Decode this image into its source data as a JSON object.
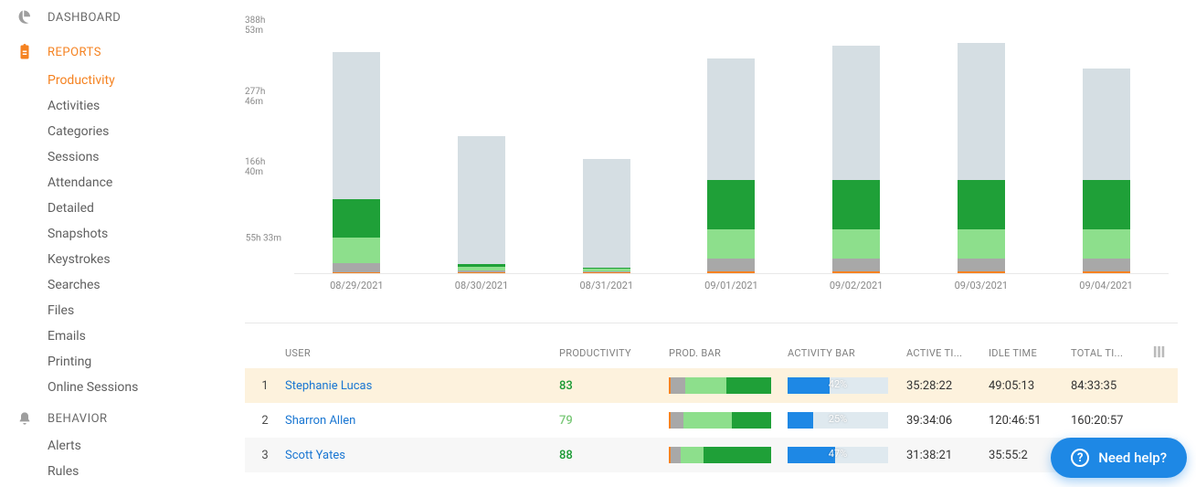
{
  "colors": {
    "idle": "#d5dee3",
    "green_dark": "#1fa038",
    "green_light": "#8ddf8c",
    "gray": "#a8a8a8",
    "orange": "#f58220",
    "blue": "#1e88e5",
    "barbg": "#dfe9ef"
  },
  "sidebar": {
    "dashboard": "DASHBOARD",
    "reports": "REPORTS",
    "behavior": "BEHAVIOR",
    "report_items": [
      "Productivity",
      "Activities",
      "Categories",
      "Sessions",
      "Attendance",
      "Detailed",
      "Snapshots",
      "Keystrokes",
      "Searches",
      "Files",
      "Emails",
      "Printing",
      "Online Sessions"
    ],
    "behavior_items": [
      "Alerts",
      "Rules"
    ]
  },
  "chart_data": {
    "type": "bar",
    "ylabel": "",
    "y_ticks": [
      "388h 53m",
      "277h 46m",
      "166h 40m",
      "55h 33m"
    ],
    "y_tick_values": [
      388.88,
      277.77,
      166.67,
      55.55
    ],
    "y_max": 388.88,
    "categories": [
      "08/29/2021",
      "08/30/2021",
      "08/31/2021",
      "09/01/2021",
      "09/02/2021",
      "09/03/2021",
      "09/04/2021"
    ],
    "stack_order": [
      "orange",
      "gray",
      "green_light",
      "green_dark",
      "idle"
    ],
    "series": [
      {
        "name": "orange",
        "color": "#f58220",
        "values": [
          2,
          1,
          1,
          3,
          3,
          3,
          3
        ]
      },
      {
        "name": "gray",
        "color": "#a8a8a8",
        "values": [
          14,
          3,
          2,
          20,
          20,
          20,
          20
        ]
      },
      {
        "name": "green_light",
        "color": "#8ddf8c",
        "values": [
          40,
          6,
          4,
          45,
          45,
          45,
          45
        ]
      },
      {
        "name": "green_dark",
        "color": "#1fa038",
        "values": [
          60,
          5,
          2,
          78,
          78,
          78,
          78
        ]
      },
      {
        "name": "idle",
        "color": "#d5dee3",
        "values": [
          230,
          200,
          170,
          190,
          210,
          215,
          175
        ]
      }
    ]
  },
  "table": {
    "columns": {
      "user": "USER",
      "productivity": "PRODUCTIVITY",
      "prod_bar": "PROD. BAR",
      "activity_bar": "ACTIVITY BAR",
      "active": "ACTIVE TI...",
      "idle": "IDLE TIME",
      "total": "TOTAL TI..."
    },
    "rows": [
      {
        "n": 1,
        "user": "Stephanie Lucas",
        "prod": 83,
        "prod_class": "prod-green",
        "prodbar": {
          "orange": 2,
          "gray": 14,
          "light": 40,
          "dark": 44
        },
        "activity": 42,
        "active": "35:28:22",
        "idle": "49:05:13",
        "total": "84:33:35",
        "hl": true
      },
      {
        "n": 2,
        "user": "Sharron Allen",
        "prod": 79,
        "prod_class": "prod-light",
        "prodbar": {
          "orange": 2,
          "gray": 12,
          "light": 48,
          "dark": 38
        },
        "activity": 25,
        "active": "39:34:06",
        "idle": "120:46:51",
        "total": "160:20:57"
      },
      {
        "n": 3,
        "user": "Scott Yates",
        "prod": 88,
        "prod_class": "prod-green",
        "prodbar": {
          "orange": 2,
          "gray": 10,
          "light": 22,
          "dark": 66
        },
        "activity": 47,
        "active": "31:38:21",
        "idle": "35:55:2",
        "total": "",
        "alt": true
      }
    ]
  },
  "help": "Need help?"
}
